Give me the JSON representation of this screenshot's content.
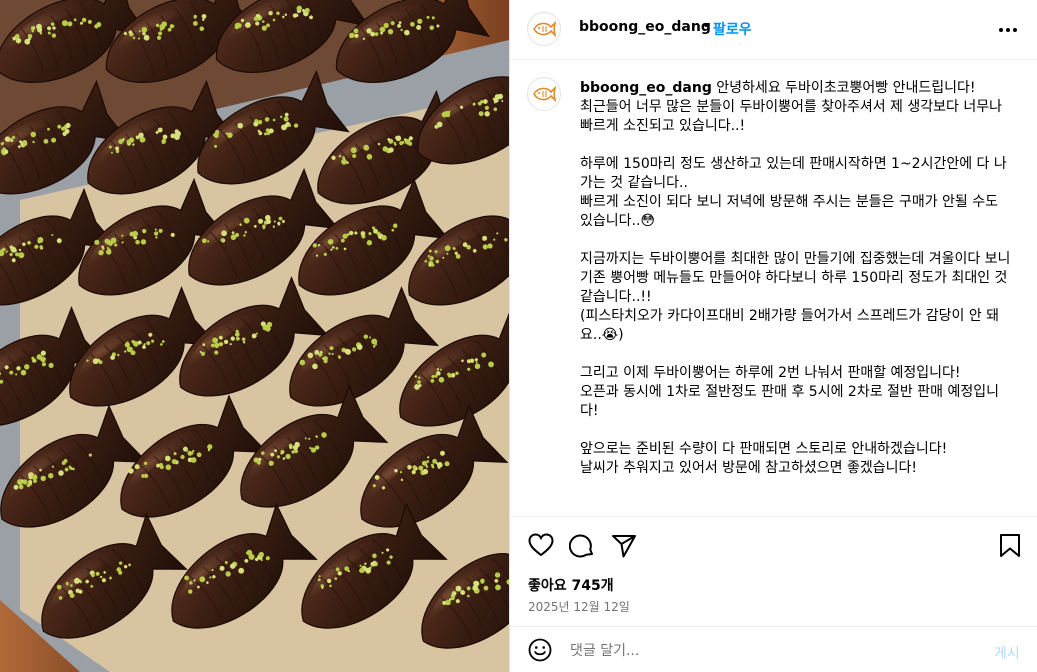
{
  "post": {
    "username": "bboong_eo_dang",
    "dot": "•",
    "follow_label": "팔로우",
    "image_alt": "Chocolate-coated fish-shaped pastries topped with pistachio crumbs",
    "caption_body": " 안녕하세요 두바이초코뿡어빵 안내드립니다!\n최근들어 너무 많은 분들이 두바이뿡어를 찾아주셔서 제 생각보다 너무나 빠르게 소진되고 있습니다..!\n\n하루에 150마리 정도 생산하고 있는데 판매시작하면 1~2시간안에 다 나가는 것 같습니다..\n빠르게 소진이 되다 보니 저녁에 방문해 주시는 분들은 구매가 안될 수도 있습니다..😳\n\n지금까지는 두바이뿡어를 최대한 많이 만들기에 집중했는데 겨울이다 보니 기존 뿡어빵 메뉴들도 만들어야 하다보니 하루 150마리 정도가 최대인 것 같습니다..!!\n(피스타치오가 카다이프대비 2배가량 들어가서 스프레드가 감당이 안 돼요..😭)\n\n그리고 이제 두바이뿡어는 하루에 2번 나눠서 판매할 예정입니다!\n오픈과 동시에 1차로 절반정도 판매 후 5시에 2차로 절반 판매 예정입니다!\n\n앞으로는 준비된 수량이 다 판매되면 스토리로 안내하겠습니다!\n날씨가 추워지고 있어서 방문에 참고하셨으면 좋겠습니다!\n\n\n.",
    "likes": "좋아요 745개",
    "date": "2025년 12월 12일"
  },
  "comment": {
    "placeholder": "댓글 달기...",
    "post_label": "게시"
  },
  "icons": {
    "like": "heart-icon",
    "comment": "comment-icon",
    "share": "send-icon",
    "save": "bookmark-icon",
    "emoji": "emoji-icon",
    "more": "more-options-icon",
    "avatar": "taiyaki-logo"
  },
  "colors": {
    "follow": "#0095f6",
    "post_disabled": "#b3dbff",
    "muted": "#737373",
    "chocolate": "#3a1e12",
    "pistachio": "#b8cc4a"
  }
}
